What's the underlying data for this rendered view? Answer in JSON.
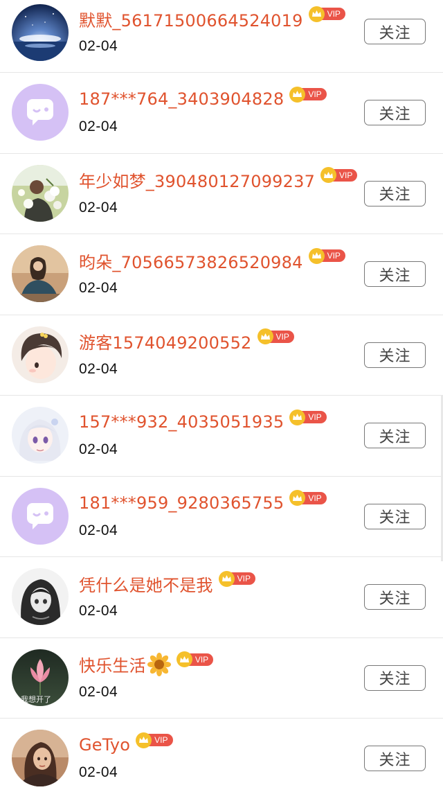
{
  "list": {
    "items": [
      {
        "name": "默默_56171500664524019",
        "date": "02-04",
        "badge": "VIP",
        "follow_label": "关注",
        "avatar": "night-sky-avatar"
      },
      {
        "name": "187***764_3403904828",
        "date": "02-04",
        "badge": "VIP",
        "follow_label": "关注",
        "avatar": "default-chat-avatar"
      },
      {
        "name": "年少如梦_390480127099237",
        "date": "02-04",
        "badge": "VIP",
        "follow_label": "关注",
        "avatar": "man-with-flowers-avatar"
      },
      {
        "name": "昀朵_70566573826520984",
        "date": "02-04",
        "badge": "VIP",
        "follow_label": "关注",
        "avatar": "sitting-girl-avatar"
      },
      {
        "name": "游客1574049200552",
        "date": "02-04",
        "badge": "VIP",
        "follow_label": "关注",
        "avatar": "cartoon-girl-avatar"
      },
      {
        "name": "157***932_4035051935",
        "date": "02-04",
        "badge": "VIP",
        "follow_label": "关注",
        "avatar": "anime-girl-avatar"
      },
      {
        "name": "181***959_9280365755",
        "date": "02-04",
        "badge": "VIP",
        "follow_label": "关注",
        "avatar": "default-chat-avatar"
      },
      {
        "name": "凭什么是她不是我",
        "date": "02-04",
        "badge": "VIP",
        "follow_label": "关注",
        "avatar": "dark-anime-girl-avatar"
      },
      {
        "name": "快乐生活",
        "date": "02-04",
        "badge": "VIP",
        "follow_label": "关注",
        "avatar": "lotus-avatar",
        "avatar_text": "我想开了",
        "emoji": "sunflower-icon"
      },
      {
        "name": "GeTyo",
        "date": "02-04",
        "badge": "VIP",
        "follow_label": "关注",
        "avatar": "portrait-woman-avatar"
      }
    ]
  },
  "colors": {
    "name": "#e0532e",
    "vip_bg": "#ea5448",
    "crown": "#f5c02a",
    "default_avatar": "#d5c1f5"
  }
}
